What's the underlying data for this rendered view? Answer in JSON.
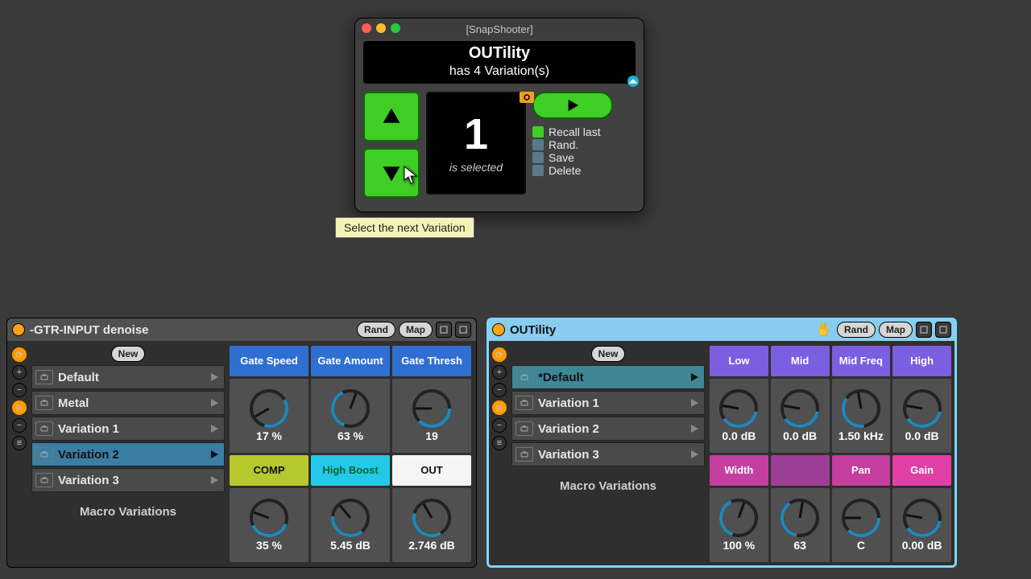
{
  "snap": {
    "window_title": "[SnapShooter]",
    "device_name": "OUTility",
    "subtitle": "has 4 Variation(s)",
    "big_number": "1",
    "is_selected_text": "is selected",
    "tooltip": "Select the next Variation",
    "options": [
      {
        "label": "Recall last",
        "color": "green"
      },
      {
        "label": "Rand.",
        "color": "grey"
      },
      {
        "label": "Save",
        "color": "grey"
      },
      {
        "label": "Delete",
        "color": "grey"
      }
    ]
  },
  "rack": {
    "devices": [
      {
        "title": "-GTR-INPUT denoise",
        "selected": false,
        "titlebar_buttons": [
          "Rand",
          "Map"
        ],
        "new_label": "New",
        "macro_variations_label": "Macro Variations",
        "variations": [
          {
            "name": "Default",
            "active": false,
            "selected": false
          },
          {
            "name": "Metal",
            "active": false,
            "selected": false
          },
          {
            "name": "Variation 1",
            "active": false,
            "selected": false
          },
          {
            "name": "Variation 2",
            "active": true,
            "selected": true
          },
          {
            "name": "Variation 3",
            "active": false,
            "selected": false
          }
        ],
        "knobs_top": [
          {
            "label": "Gate Speed",
            "value": "17 %",
            "angle": -120,
            "color": "h-blue"
          },
          {
            "label": "Gate Amount",
            "value": "63 %",
            "angle": 20,
            "color": "h-blue"
          },
          {
            "label": "Gate Thresh",
            "value": "19",
            "angle": -90,
            "color": "h-blue"
          }
        ],
        "knobs_bot": [
          {
            "label": "COMP",
            "value": "35 %",
            "angle": -70,
            "color": "h-olive"
          },
          {
            "label": "High Boost",
            "value": "5.45 dB",
            "angle": -40,
            "color": "h-cyan"
          },
          {
            "label": "OUT",
            "value": "2.746 dB",
            "angle": -30,
            "color": "h-white"
          }
        ]
      },
      {
        "title": "OUTility",
        "selected": true,
        "hand": true,
        "titlebar_buttons": [
          "Rand",
          "Map"
        ],
        "new_label": "New",
        "macro_variations_label": "Macro Variations",
        "variations": [
          {
            "name": "*Default",
            "active": true,
            "selected": true
          },
          {
            "name": "Variation 1",
            "active": false,
            "selected": false
          },
          {
            "name": "Variation 2",
            "active": false,
            "selected": false
          },
          {
            "name": "Variation 3",
            "active": false,
            "selected": false
          }
        ],
        "knobs_top": [
          {
            "label": "Low",
            "value": "0.0 dB",
            "angle": -80,
            "color": "h-purple"
          },
          {
            "label": "Mid",
            "value": "0.0 dB",
            "angle": -80,
            "color": "h-purple"
          },
          {
            "label": "Mid Freq",
            "value": "1.50 kHz",
            "angle": -10,
            "color": "h-purple"
          },
          {
            "label": "High",
            "value": "0.0 dB",
            "angle": -80,
            "color": "h-purple"
          }
        ],
        "knobs_bot": [
          {
            "label": "Width",
            "value": "100 %",
            "angle": 20,
            "color": "h-magenta"
          },
          {
            "label": "",
            "value": "63",
            "angle": 10,
            "color": "h-empty"
          },
          {
            "label": "Pan",
            "value": "C",
            "angle": -90,
            "color": "h-magenta"
          },
          {
            "label": "Gain",
            "value": "0.00 dB",
            "angle": -80,
            "color": "h-pink"
          }
        ]
      }
    ]
  }
}
